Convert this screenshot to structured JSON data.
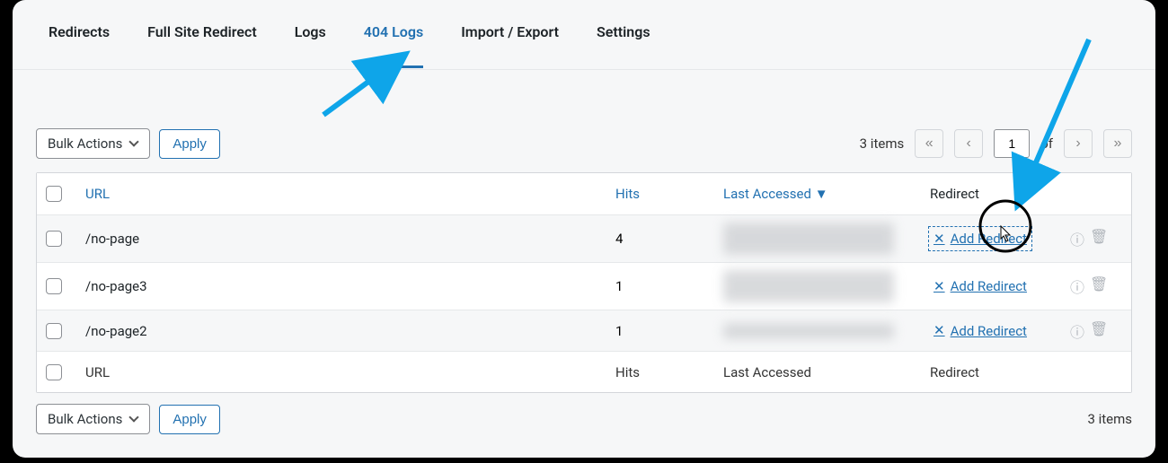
{
  "tabs": [
    "Redirects",
    "Full Site Redirect",
    "Logs",
    "404 Logs",
    "Import / Export",
    "Settings"
  ],
  "active_tab": "404 Logs",
  "bulk_actions_label": "Bulk Actions",
  "apply_label": "Apply",
  "item_count_text": "3 items",
  "pager": {
    "page": "1",
    "of_label": "of"
  },
  "columns": {
    "url": "URL",
    "hits": "Hits",
    "last": "Last Accessed",
    "redirect": "Redirect"
  },
  "sort_indicator": "▼",
  "rows": [
    {
      "url": "/no-page",
      "hits": "4",
      "add_label": "Add Redirect"
    },
    {
      "url": "/no-page3",
      "hits": "1",
      "add_label": "Add Redirect"
    },
    {
      "url": "/no-page2",
      "hits": "1",
      "add_label": "Add Redirect"
    }
  ],
  "footer_columns": {
    "url": "URL",
    "hits": "Hits",
    "last": "Last Accessed",
    "redirect": "Redirect"
  },
  "colors": {
    "accent": "#2271b1",
    "annotation": "#0ea5e9"
  }
}
